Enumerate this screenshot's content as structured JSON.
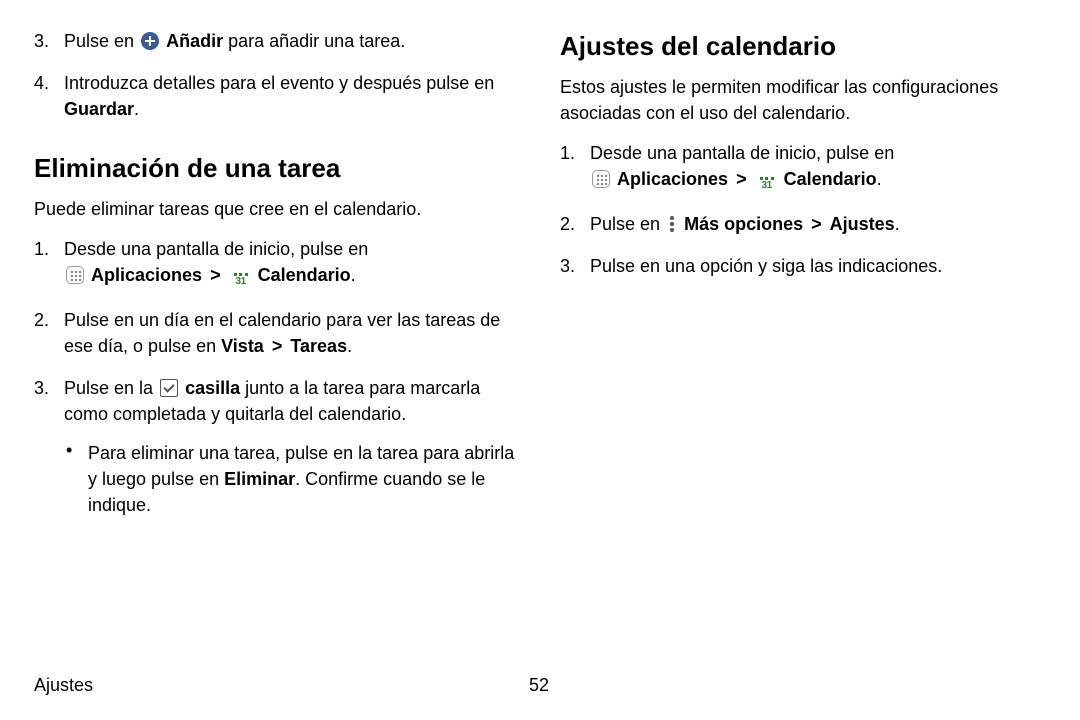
{
  "left": {
    "step3_a": "Pulse en ",
    "step3_b": "Añadir",
    "step3_c": " para añadir una tarea.",
    "step4_a": "Introduzca detalles para el evento y después pulse en ",
    "step4_b": "Guardar",
    "step4_c": ".",
    "h2": "Eliminación de una tarea",
    "intro": "Puede eliminar tareas que cree en el calendario.",
    "d1_a": "Desde una pantalla de inicio, pulse en ",
    "apps": "Aplicaciones",
    "cal": "Calendario",
    "d2_a": "Pulse en un día en el calendario para ver las tareas de ese día, o pulse en ",
    "d2_b": "Vista",
    "d2_c": "Tareas",
    "d3_a": "Pulse en la ",
    "d3_b": "casilla",
    "d3_c": " junto a la tarea para marcarla como completada y quitarla del calendario.",
    "bullet_a": "Para eliminar una tarea, pulse en la tarea para abrirla y luego pulse en ",
    "bullet_b": "Eliminar",
    "bullet_c": ". Confirme cuando se le indique."
  },
  "right": {
    "h2": "Ajustes del calendario",
    "intro": "Estos ajustes le permiten modificar las configuraciones asociadas con el uso del calendario.",
    "r1_a": "Desde una pantalla de inicio, pulse en ",
    "apps": "Aplicaciones",
    "cal": "Calendario",
    "r2_a": "Pulse en ",
    "r2_b": "Más opciones",
    "r2_c": "Ajustes",
    "r3": "Pulse en una opción y siga las indicaciones."
  },
  "cal_day": "31",
  "nums": {
    "n1": "1.",
    "n2": "2.",
    "n3": "3.",
    "n4": "4."
  },
  "chev": ">",
  "period": ".",
  "bullet": "•",
  "footer": {
    "section": "Ajustes",
    "page": "52"
  }
}
